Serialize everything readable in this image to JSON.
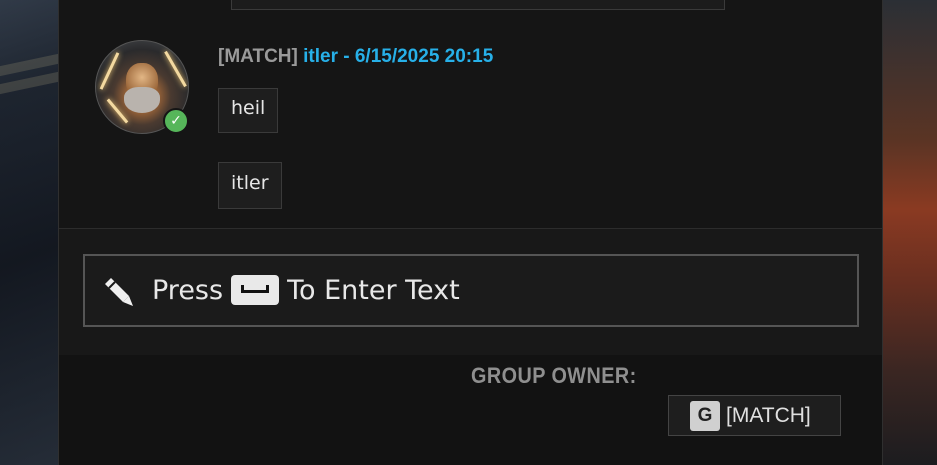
{
  "chat": {
    "message": {
      "sender_tag": "[MATCH]",
      "sender_meta": "itler - 6/15/2025 20:15",
      "lines": [
        "heil",
        "itler"
      ]
    },
    "input": {
      "prefix": "Press",
      "suffix": "To Enter Text",
      "key_icon": "spacebar-key-icon"
    }
  },
  "group": {
    "owner_label": "GROUP OWNER:",
    "owner_icon_letter": "G",
    "owner_name": "[MATCH]"
  },
  "colors": {
    "meta_blue": "#27b0e8",
    "online_green": "#56b65a"
  }
}
